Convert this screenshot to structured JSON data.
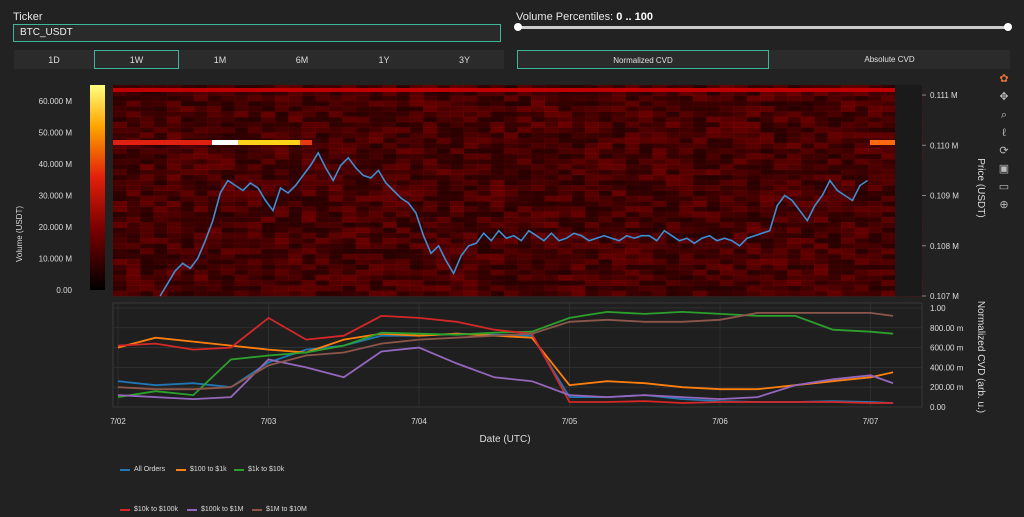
{
  "ticker": {
    "label": "Ticker",
    "value": "BTC_USDT"
  },
  "volume_percentiles": {
    "label": "Volume Percentiles:",
    "range_text": "0 .. 100",
    "low": 0,
    "high": 100
  },
  "timeframes": [
    {
      "label": "1D",
      "active": false
    },
    {
      "label": "1W",
      "active": true
    },
    {
      "label": "1M",
      "active": false
    },
    {
      "label": "6M",
      "active": false
    },
    {
      "label": "1Y",
      "active": false
    },
    {
      "label": "3Y",
      "active": false
    }
  ],
  "cvd_modes": [
    {
      "label": "Normalized CVD",
      "active": true
    },
    {
      "label": "Absolute CVD",
      "active": false
    }
  ],
  "modebar_icons": [
    "plotly-logo-icon",
    "pan-icon",
    "zoom-icon",
    "lasso-icon",
    "reset-icon",
    "download-icon",
    "hover-icon",
    "spike-icon"
  ],
  "colors": {
    "accent": "#3fb59c",
    "price_line": "#3a8fd6",
    "all_orders": "#1f77b4",
    "s100_1k": "#ff7f0e",
    "s1k_10k": "#2ca02c",
    "s10k_100k": "#d62728",
    "s100k_1m": "#9467bd",
    "s1m_10m": "#8c564b"
  },
  "chart_data": [
    {
      "type": "heatmap",
      "title": "",
      "xlabel": "",
      "ylabel": "Price (USDT)",
      "colorbar_label": "Volume (USDT)",
      "colorbar_ticks": [
        "60.000 M",
        "50.000 M",
        "40.000 M",
        "30.000 M",
        "20.000 M",
        "10.000 M",
        "0.00"
      ],
      "colorbar_range": [
        0,
        65
      ],
      "ylim": [
        0.107,
        0.1112
      ],
      "y_ticks": [
        0.107,
        0.108,
        0.109,
        0.11,
        0.111
      ],
      "y_tick_labels": [
        "0.107 M",
        "0.108 M",
        "0.109 M",
        "0.110 M",
        "0.111 M"
      ],
      "price_series": {
        "name": "Price",
        "x": [
          0.5,
          0.55,
          0.6,
          0.65,
          0.7,
          0.75,
          0.8,
          0.85,
          0.9,
          0.95,
          1.0,
          1.05,
          1.1,
          1.15,
          1.2,
          1.25,
          1.3,
          1.35,
          1.4,
          1.45,
          1.5,
          1.55,
          1.6,
          1.65,
          1.7,
          1.75,
          1.8,
          1.85,
          1.9,
          1.95,
          2.0,
          2.05,
          2.1,
          2.15,
          2.2,
          2.25,
          2.3,
          2.35,
          2.4,
          2.45,
          2.5,
          2.55,
          2.6,
          2.65,
          2.7,
          2.75,
          2.8,
          2.85,
          2.9,
          2.95,
          3.0,
          3.05,
          3.1,
          3.15,
          3.2,
          3.25,
          3.3,
          3.35,
          3.4,
          3.45,
          3.5,
          3.55,
          3.6,
          3.65,
          3.7,
          3.75,
          3.8,
          3.85,
          3.9,
          3.95,
          4.0,
          4.05,
          4.1,
          4.15,
          4.2,
          4.25,
          4.3,
          4.35,
          4.4,
          4.45,
          4.5,
          4.55,
          4.6,
          4.65,
          4.7,
          4.75,
          4.8,
          4.85,
          4.9,
          4.95,
          5.0,
          5.05,
          5.1,
          5.15,
          5.2
        ],
        "y": [
          0.107,
          0.10725,
          0.1075,
          0.10765,
          0.10755,
          0.10775,
          0.1081,
          0.1085,
          0.10905,
          0.1093,
          0.1092,
          0.1091,
          0.10925,
          0.10915,
          0.1089,
          0.1087,
          0.10915,
          0.10905,
          0.1092,
          0.1094,
          0.1096,
          0.10985,
          0.10955,
          0.1093,
          0.1096,
          0.10975,
          0.10955,
          0.1094,
          0.10935,
          0.1095,
          0.10925,
          0.1091,
          0.10895,
          0.10885,
          0.10865,
          0.1082,
          0.10785,
          0.108,
          0.1077,
          0.10745,
          0.1078,
          0.108,
          0.10805,
          0.10825,
          0.1081,
          0.1083,
          0.10815,
          0.1082,
          0.1081,
          0.1083,
          0.1082,
          0.1081,
          0.10825,
          0.1081,
          0.10815,
          0.10825,
          0.1082,
          0.1081,
          0.10815,
          0.1082,
          0.10815,
          0.1081,
          0.1082,
          0.10815,
          0.1082,
          0.1082,
          0.1081,
          0.1083,
          0.1082,
          0.1081,
          0.10815,
          0.10805,
          0.10815,
          0.1082,
          0.1081,
          0.10815,
          0.1081,
          0.108,
          0.10815,
          0.1082,
          0.10825,
          0.1083,
          0.1088,
          0.109,
          0.1089,
          0.1087,
          0.1085,
          0.1088,
          0.109,
          0.1093,
          0.1091,
          0.109,
          0.1089,
          0.1092,
          0.1093
        ]
      }
    },
    {
      "type": "line",
      "title": "",
      "xlabel": "Date (UTC)",
      "ylabel": "Normalized CVD (arb. u.)",
      "ylim": [
        0,
        1.05
      ],
      "y_ticks": [
        0,
        0.2,
        0.4,
        0.6,
        0.8,
        1.0
      ],
      "y_tick_labels": [
        "0.00",
        "200.00 m",
        "400.00 m",
        "600.00 m",
        "800.00 m",
        "1.00"
      ],
      "xlim": [
        0,
        5.27
      ],
      "x_ticks": [
        0,
        1,
        2,
        3,
        4,
        5
      ],
      "x_tick_labels": [
        "7/02",
        "7/03",
        "7/04",
        "7/05",
        "7/06",
        "7/07"
      ],
      "x": [
        0,
        0.25,
        0.5,
        0.75,
        1.0,
        1.25,
        1.5,
        1.75,
        2.0,
        2.25,
        2.5,
        2.75,
        3.0,
        3.25,
        3.5,
        3.75,
        4.0,
        4.25,
        4.5,
        4.75,
        5.0,
        5.15
      ],
      "series": [
        {
          "name": "All Orders",
          "color_key": "all_orders",
          "values": [
            0.26,
            0.22,
            0.24,
            0.2,
            0.45,
            0.58,
            0.62,
            0.72,
            0.72,
            0.74,
            0.73,
            0.72,
            0.1,
            0.1,
            0.12,
            0.08,
            0.06,
            0.05,
            0.05,
            0.06,
            0.05,
            0.04
          ]
        },
        {
          "name": "$100 to $1k",
          "color_key": "s100_1k",
          "values": [
            0.6,
            0.7,
            0.66,
            0.62,
            0.58,
            0.55,
            0.68,
            0.74,
            0.72,
            0.74,
            0.72,
            0.7,
            0.22,
            0.26,
            0.24,
            0.2,
            0.18,
            0.18,
            0.22,
            0.26,
            0.3,
            0.35
          ]
        },
        {
          "name": "$1k to $10k",
          "color_key": "s1k_10k",
          "values": [
            0.1,
            0.16,
            0.12,
            0.48,
            0.52,
            0.55,
            0.62,
            0.75,
            0.74,
            0.73,
            0.75,
            0.76,
            0.9,
            0.96,
            0.94,
            0.96,
            0.94,
            0.92,
            0.92,
            0.78,
            0.76,
            0.74
          ]
        },
        {
          "name": "$10k to $100k",
          "color_key": "s10k_100k",
          "values": [
            0.62,
            0.64,
            0.58,
            0.6,
            0.9,
            0.68,
            0.72,
            0.92,
            0.9,
            0.86,
            0.78,
            0.74,
            0.05,
            0.05,
            0.06,
            0.04,
            0.05,
            0.05,
            0.05,
            0.05,
            0.04,
            0.04
          ]
        },
        {
          "name": "$100k to $1M",
          "color_key": "s100k_1m",
          "values": [
            0.12,
            0.1,
            0.08,
            0.1,
            0.48,
            0.4,
            0.3,
            0.56,
            0.6,
            0.44,
            0.3,
            0.26,
            0.12,
            0.1,
            0.12,
            0.1,
            0.08,
            0.1,
            0.22,
            0.28,
            0.32,
            0.24
          ]
        },
        {
          "name": "$1M to $10M",
          "color_key": "s1m_10m",
          "values": [
            0.2,
            0.18,
            0.18,
            0.2,
            0.42,
            0.52,
            0.55,
            0.64,
            0.68,
            0.7,
            0.72,
            0.74,
            0.86,
            0.88,
            0.86,
            0.86,
            0.88,
            0.95,
            0.95,
            0.95,
            0.95,
            0.92
          ]
        }
      ]
    }
  ]
}
